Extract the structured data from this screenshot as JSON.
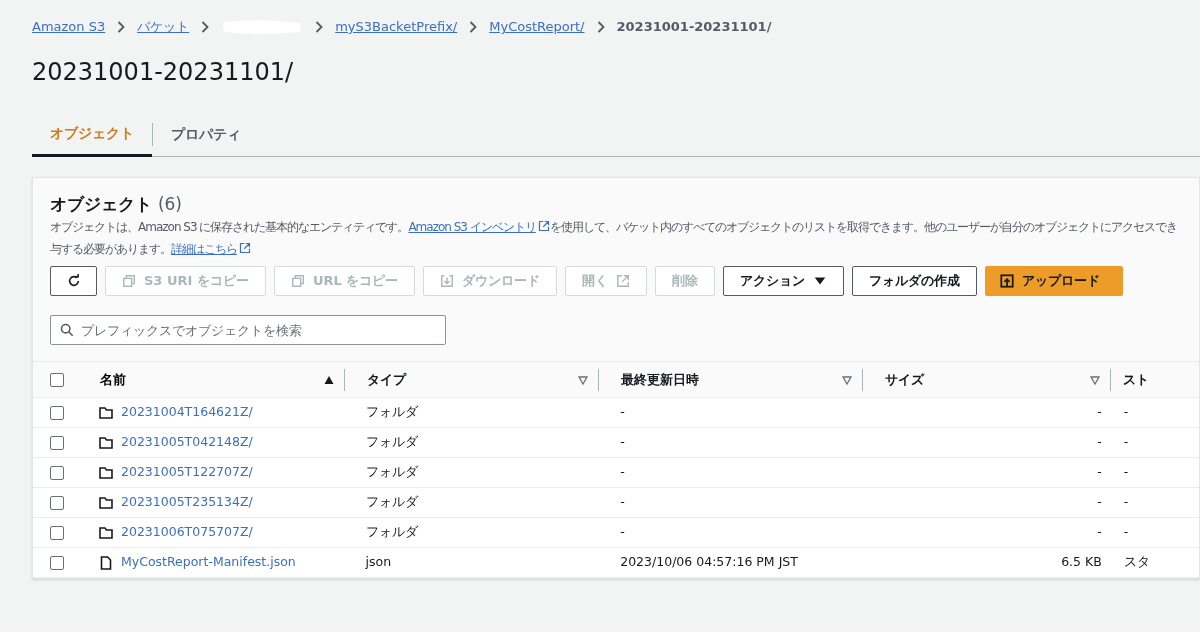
{
  "breadcrumb": [
    {
      "kind": "link",
      "label": "Amazon S3"
    },
    {
      "kind": "link",
      "label": "バケット"
    },
    {
      "kind": "redacted"
    },
    {
      "kind": "link",
      "label": "myS3BacketPrefix/"
    },
    {
      "kind": "link",
      "label": "MyCostReport/"
    },
    {
      "kind": "current",
      "label": "20231001-20231101/"
    }
  ],
  "title": "20231001-20231101/",
  "tabs": [
    {
      "label": "オブジェクト",
      "selected": true
    },
    {
      "label": "プロパティ",
      "selected": false
    }
  ],
  "panel": {
    "heading": "オブジェクト",
    "count": "(6)",
    "description": [
      [
        {
          "kind": "text",
          "text": "オブジェクトは、Amazon S3 に保存された基本的なエンティティです。"
        },
        {
          "kind": "link",
          "text": "Amazon S3 インベントリ"
        },
        {
          "kind": "text",
          "text": "を使用して、バケット内のすべてのオブジェクトのリストを取得できます。他のユーザーが自分のオブジェクトにアクセスでき"
        }
      ],
      [
        {
          "kind": "text",
          "text": "与する必要があります。"
        },
        {
          "kind": "link",
          "text": "詳細はこちら"
        }
      ]
    ],
    "buttons": [
      {
        "kind": "refresh",
        "disabled": false
      },
      {
        "kind": "copy",
        "label": "S3 URI をコピー",
        "disabled": true
      },
      {
        "kind": "copy",
        "label": "URL をコピー",
        "disabled": true
      },
      {
        "kind": "download",
        "label": "ダウンロード",
        "disabled": true
      },
      {
        "kind": "open",
        "label": "開く",
        "disabled": true
      },
      {
        "kind": "plain",
        "label": "削除",
        "disabled": true
      },
      {
        "kind": "dropdown",
        "label": "アクション",
        "disabled": false
      },
      {
        "kind": "plain",
        "label": "フォルダの作成",
        "disabled": false
      },
      {
        "kind": "upload",
        "label": "アップロード",
        "disabled": false
      }
    ],
    "search": {
      "placeholder": "プレフィックスでオブジェクトを検索"
    },
    "table": {
      "select_all_checked": false,
      "columns": [
        {
          "label": "名前",
          "sorted": true
        },
        {
          "label": "タイプ",
          "sorted": false
        },
        {
          "label": "最終更新日時",
          "sorted": false
        },
        {
          "label": "サイズ",
          "sorted": false
        },
        {
          "label": "スト",
          "sorted": false
        }
      ],
      "rows": [
        {
          "kind": "folder",
          "checked": false,
          "name": "20231004T164621Z/",
          "type": "フォルダ",
          "modified": "-",
          "size": "-",
          "storage": "-"
        },
        {
          "kind": "folder",
          "checked": false,
          "name": "20231005T042148Z/",
          "type": "フォルダ",
          "modified": "-",
          "size": "-",
          "storage": "-"
        },
        {
          "kind": "folder",
          "checked": false,
          "name": "20231005T122707Z/",
          "type": "フォルダ",
          "modified": "-",
          "size": "-",
          "storage": "-"
        },
        {
          "kind": "folder",
          "checked": false,
          "name": "20231005T235134Z/",
          "type": "フォルダ",
          "modified": "-",
          "size": "-",
          "storage": "-"
        },
        {
          "kind": "folder",
          "checked": false,
          "name": "20231006T075707Z/",
          "type": "フォルダ",
          "modified": "-",
          "size": "-",
          "storage": "-"
        },
        {
          "kind": "file",
          "checked": false,
          "name": "MyCostReport-Manifest.json",
          "type": "json",
          "modified": "2023/10/06 04:57:16 PM JST",
          "size": "6.5 KB",
          "storage": "スタ"
        }
      ]
    }
  }
}
